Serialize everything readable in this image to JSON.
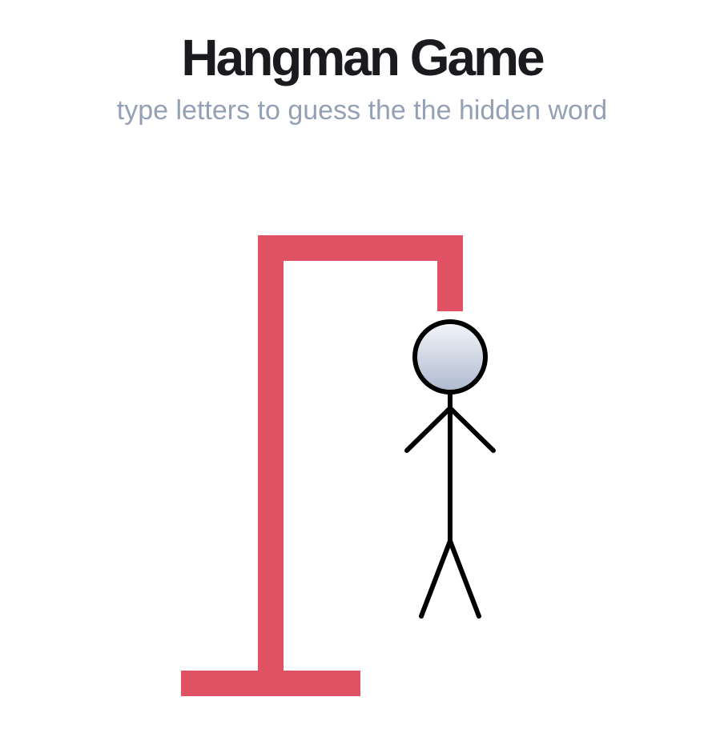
{
  "header": {
    "title": "Hangman Game",
    "subtitle": "type letters to guess the the hidden word"
  },
  "colors": {
    "title": "#1b1b1f",
    "subtitle": "#94a0b4",
    "gallows": "#e05263",
    "figure_stroke": "#000000",
    "head_fill_top": "#f4f6fa",
    "head_fill_bottom": "#aeb9cf"
  },
  "game": {
    "wrong_guesses": 6,
    "max_wrong_guesses": 6,
    "figure_parts_shown": [
      "head",
      "body",
      "left-arm",
      "right-arm",
      "left-leg",
      "right-leg"
    ]
  }
}
